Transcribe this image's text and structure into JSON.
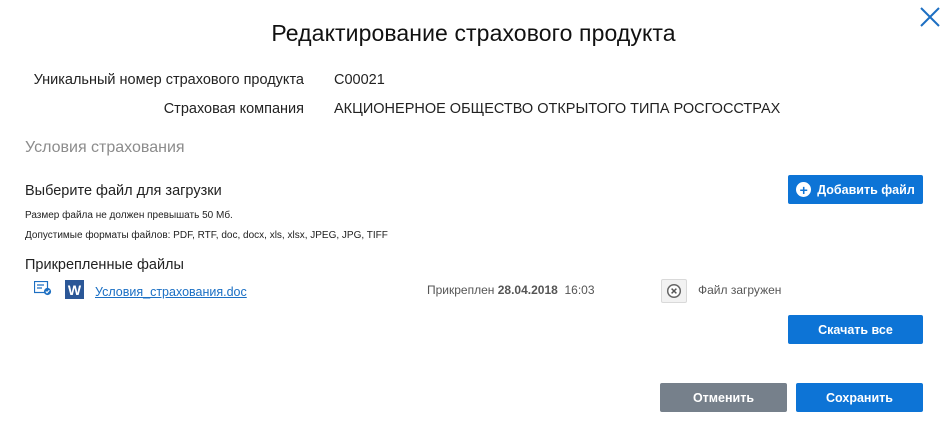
{
  "dialog": {
    "title": "Редактирование страхового продукта"
  },
  "fields": {
    "product_number_label": "Уникальный номер страхового продукта",
    "product_number_value": "C00021",
    "company_label": "Страховая компания",
    "company_value": "АКЦИОНЕРНОЕ ОБЩЕСТВО ОТКРЫТОГО ТИПА РОСГОССТРАХ"
  },
  "conditions": {
    "section_title": "Условия страхования",
    "upload_label": "Выберите файл для загрузки",
    "size_note": "Размер файла не должен превышать 50 Мб.",
    "formats_note": "Допустимые форматы файлов: PDF, RTF, doc, docx, xls, xlsx, JPEG, JPG, TIFF",
    "add_file_button": "Добавить файл",
    "attached_label": "Прикрепленные файлы"
  },
  "files": [
    {
      "name": "Условия_страхования.doc",
      "attached_prefix": "Прикреплен",
      "attached_date": "28.04.2018",
      "attached_time": "16:03",
      "status": "Файл загружен",
      "type_icon_letter": "W"
    }
  ],
  "actions": {
    "download_all": "Скачать все",
    "cancel": "Отменить",
    "save": "Сохранить"
  },
  "colors": {
    "primary": "#0d74d6",
    "secondary": "#76808b",
    "link": "#1a6fc4",
    "section_title": "#8c8c8c",
    "word_icon": "#2b5797"
  },
  "icons": {
    "close": "close-icon",
    "plus": "plus-circle-icon",
    "signature": "signature-icon",
    "word": "word-doc-icon",
    "remove": "remove-circle-icon"
  }
}
